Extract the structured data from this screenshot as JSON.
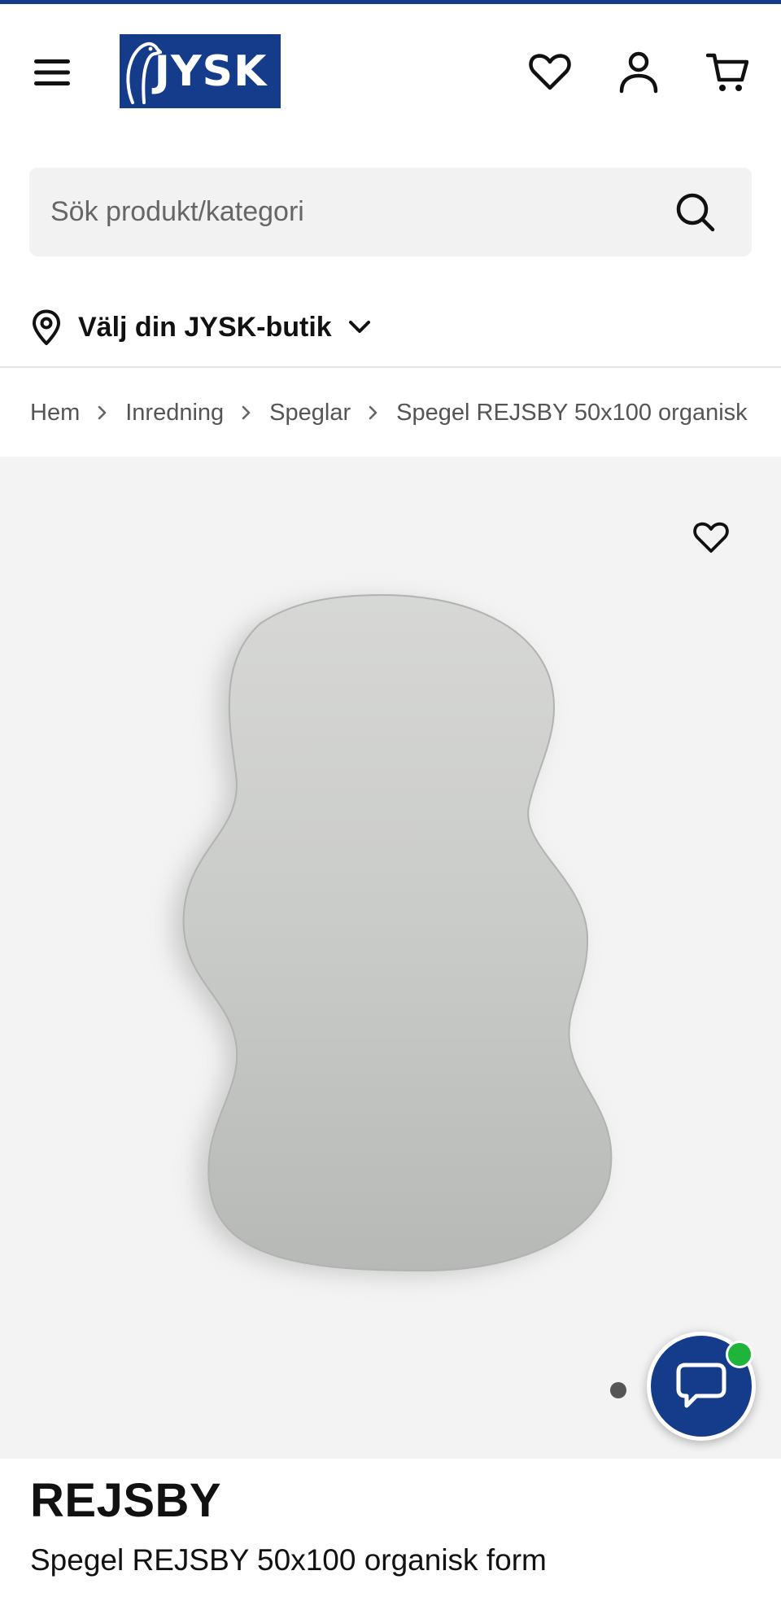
{
  "colors": {
    "brand": "#143c8a",
    "online": "#1fb43a",
    "background_gallery": "#f3f3f3"
  },
  "header": {
    "logo_text": "JYSK",
    "icons": [
      "menu-icon",
      "heart-icon",
      "user-icon",
      "cart-icon"
    ]
  },
  "search": {
    "placeholder": "Sök produkt/kategori",
    "icon": "search-icon"
  },
  "store": {
    "label": "Välj din JYSK-butik",
    "icon": "location-pin-icon"
  },
  "breadcrumb": {
    "items": [
      "Hem",
      "Inredning",
      "Speglar"
    ],
    "current": "Spegel REJSBY 50x100 organisk"
  },
  "gallery": {
    "image_count": 1,
    "active_index": 1
  },
  "product": {
    "brand": "REJSBY",
    "name": "Spegel REJSBY 50x100 organisk form"
  }
}
